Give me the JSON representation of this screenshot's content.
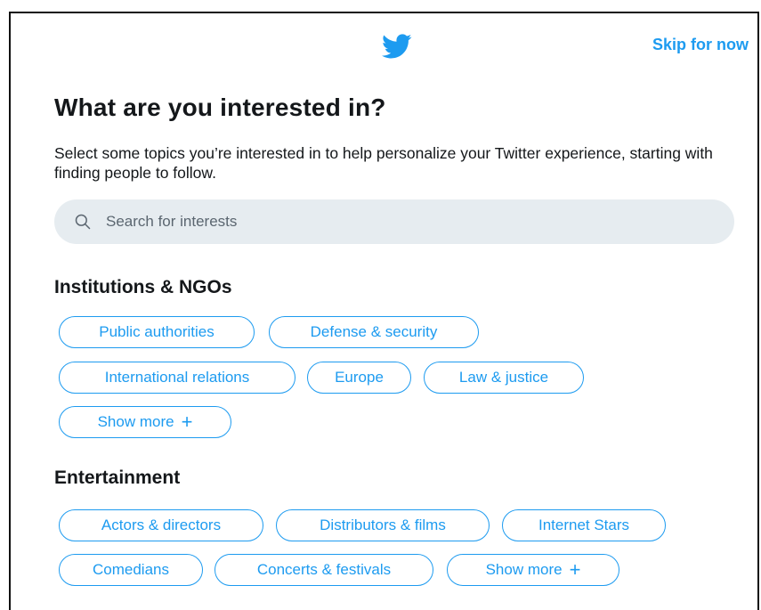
{
  "header": {
    "skip_label": "Skip for now"
  },
  "heading": "What are you interested in?",
  "subtitle": "Select some topics you’re interested in to help personalize your Twitter experience, starting with finding people to follow.",
  "search": {
    "placeholder": "Search for interests"
  },
  "sections": [
    {
      "title": "Institutions & NGOs",
      "topics": [
        "Public authorities",
        "Defense & security",
        "International relations",
        "Europe",
        "Law & justice"
      ],
      "show_more": "Show more",
      "show_more_icon": "+"
    },
    {
      "title": "Entertainment",
      "topics": [
        "Actors & directors",
        "Distributors & films",
        "Internet Stars",
        "Comedians",
        "Concerts & festivals"
      ],
      "show_more": "Show more",
      "show_more_icon": "+"
    }
  ],
  "colors": {
    "accent": "#1d9bf0",
    "search_bg": "#e6ecf0",
    "text": "#14171a"
  }
}
